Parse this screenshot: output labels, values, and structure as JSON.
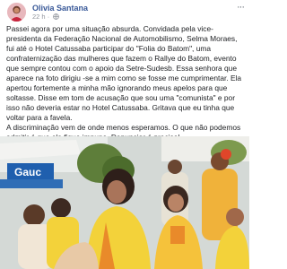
{
  "post": {
    "author_name": "Olivia Santana",
    "timestamp": "22 h",
    "separator": "·",
    "privacy_icon": "globe-icon",
    "more_icon": "more-options-icon",
    "paragraphs": [
      "Passei agora por uma situação absurda. Convidada pela vice-presidenta da Federação Nacional de Automobilismo, Selma Moraes, fui até o Hotel Catussaba participar do \"Folia do Batom\", uma confraternização das mulheres que fazem o Rallye do Batom, evento que sempre contou com o apoio da Setre-Sudesb. Essa senhora que aparece na foto dirigiu -se a mim como se fosse me cumprimentar. Ela apertou fortemente a minha mão ignorando meus apelos para que soltasse. Disse em tom de acusação que sou uma \"comunista\" e por isso não deveria estar no Hotel Catussaba. Gritava que eu tinha que voltar para a favela.",
      "A discriminação vem de onde menos esperamos. O que não podemos admitir é que ela fique impune. Denunciar é preciso!"
    ]
  },
  "photo": {
    "banner_text": "Gauc",
    "colors": {
      "dress_yellow": "#f3d23a",
      "dress_orange": "#e98a2a",
      "tent_blue": "#1f5fae",
      "foliage_green": "#5e7e3a"
    }
  },
  "colors": {
    "author_link": "#385898",
    "meta_gray": "#90949c",
    "text": "#1c1e21"
  }
}
